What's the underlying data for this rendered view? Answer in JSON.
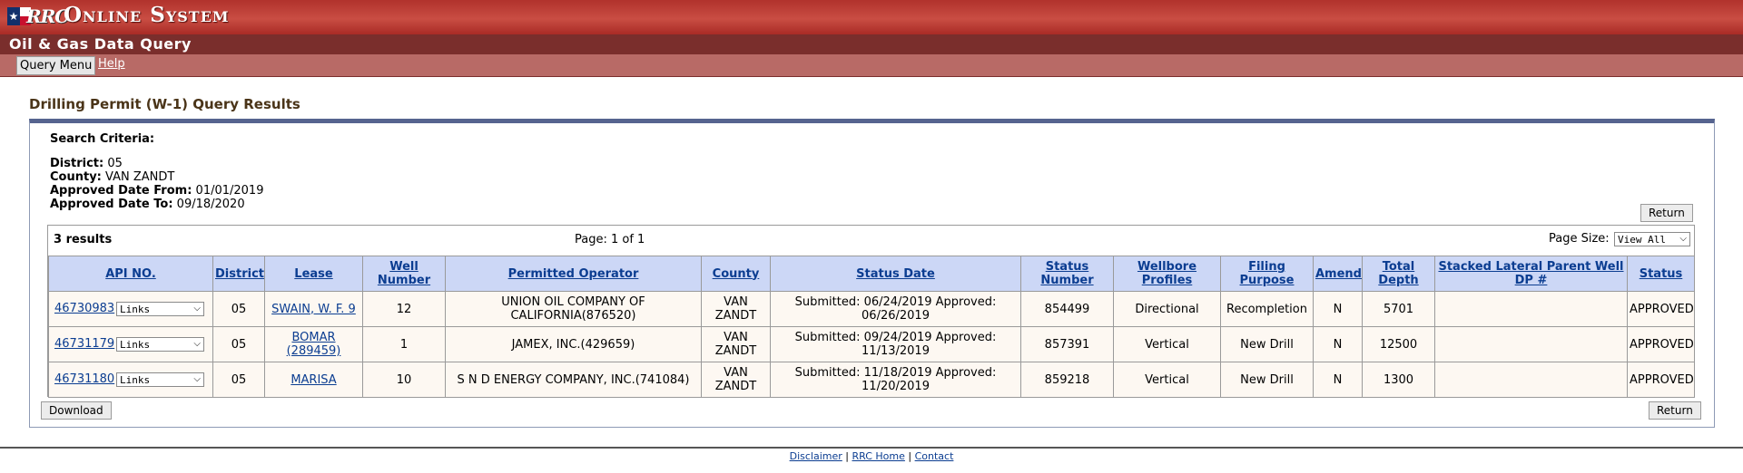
{
  "header": {
    "logo_text": "RRC",
    "system_title": "Online System",
    "subtitle": "Oil & Gas Data Query",
    "menu": {
      "query_menu_label": "Query Menu",
      "help_label": "Help"
    }
  },
  "page": {
    "title": "Drilling Permit (W-1) Query Results"
  },
  "search_criteria": {
    "heading": "Search Criteria:",
    "district_label": "District:",
    "district_value": "05",
    "county_label": "County:",
    "county_value": "VAN ZANDT",
    "approved_from_label": "Approved Date From:",
    "approved_from_value": "01/01/2019",
    "approved_to_label": "Approved Date To:",
    "approved_to_value": "09/18/2020"
  },
  "buttons": {
    "return_label": "Return",
    "download_label": "Download"
  },
  "results": {
    "count_label": "3 results",
    "page_label": "Page: 1 of 1",
    "page_size_label": "Page Size:",
    "page_size_value": "View All",
    "columns": [
      "API NO.",
      "District",
      "Lease",
      "Well Number",
      "Permitted Operator",
      "County",
      "Status Date",
      "Status Number",
      "Wellbore Profiles",
      "Filing Purpose",
      "Amend",
      "Total Depth",
      "Stacked Lateral Parent Well DP #",
      "Status"
    ],
    "links_label": "Links",
    "rows": [
      {
        "api": "46730983",
        "district": "05",
        "lease": "SWAIN, W. F. 9",
        "well_number": "12",
        "operator": "UNION OIL COMPANY OF CALIFORNIA(876520)",
        "county": "VAN ZANDT",
        "status_date": "Submitted: 06/24/2019 Approved: 06/26/2019",
        "status_number": "854499",
        "wellbore": "Directional",
        "filing_purpose": "Recompletion",
        "amend": "N",
        "total_depth": "5701",
        "stacked": "",
        "status": "APPROVED"
      },
      {
        "api": "46731179",
        "district": "05",
        "lease": "BOMAR (289459)",
        "well_number": "1",
        "operator": "JAMEX, INC.(429659)",
        "county": "VAN ZANDT",
        "status_date": "Submitted: 09/24/2019 Approved: 11/13/2019",
        "status_number": "857391",
        "wellbore": "Vertical",
        "filing_purpose": "New Drill",
        "amend": "N",
        "total_depth": "12500",
        "stacked": "",
        "status": "APPROVED"
      },
      {
        "api": "46731180",
        "district": "05",
        "lease": "MARISA",
        "well_number": "10",
        "operator": "S N D ENERGY COMPANY, INC.(741084)",
        "county": "VAN ZANDT",
        "status_date": "Submitted: 11/18/2019 Approved: 11/20/2019",
        "status_number": "859218",
        "wellbore": "Vertical",
        "filing_purpose": "New Drill",
        "amend": "N",
        "total_depth": "1300",
        "stacked": "",
        "status": "APPROVED"
      }
    ]
  },
  "footer": {
    "disclaimer": "Disclaimer",
    "home": "RRC Home",
    "contact": "Contact",
    "separator": "|"
  },
  "colors": {
    "header_red": "#b1322c",
    "header_dark": "#7a2e2c",
    "table_header": "#ccd7f6",
    "row_bg": "#fdf8f2",
    "link": "#0b3d91"
  }
}
